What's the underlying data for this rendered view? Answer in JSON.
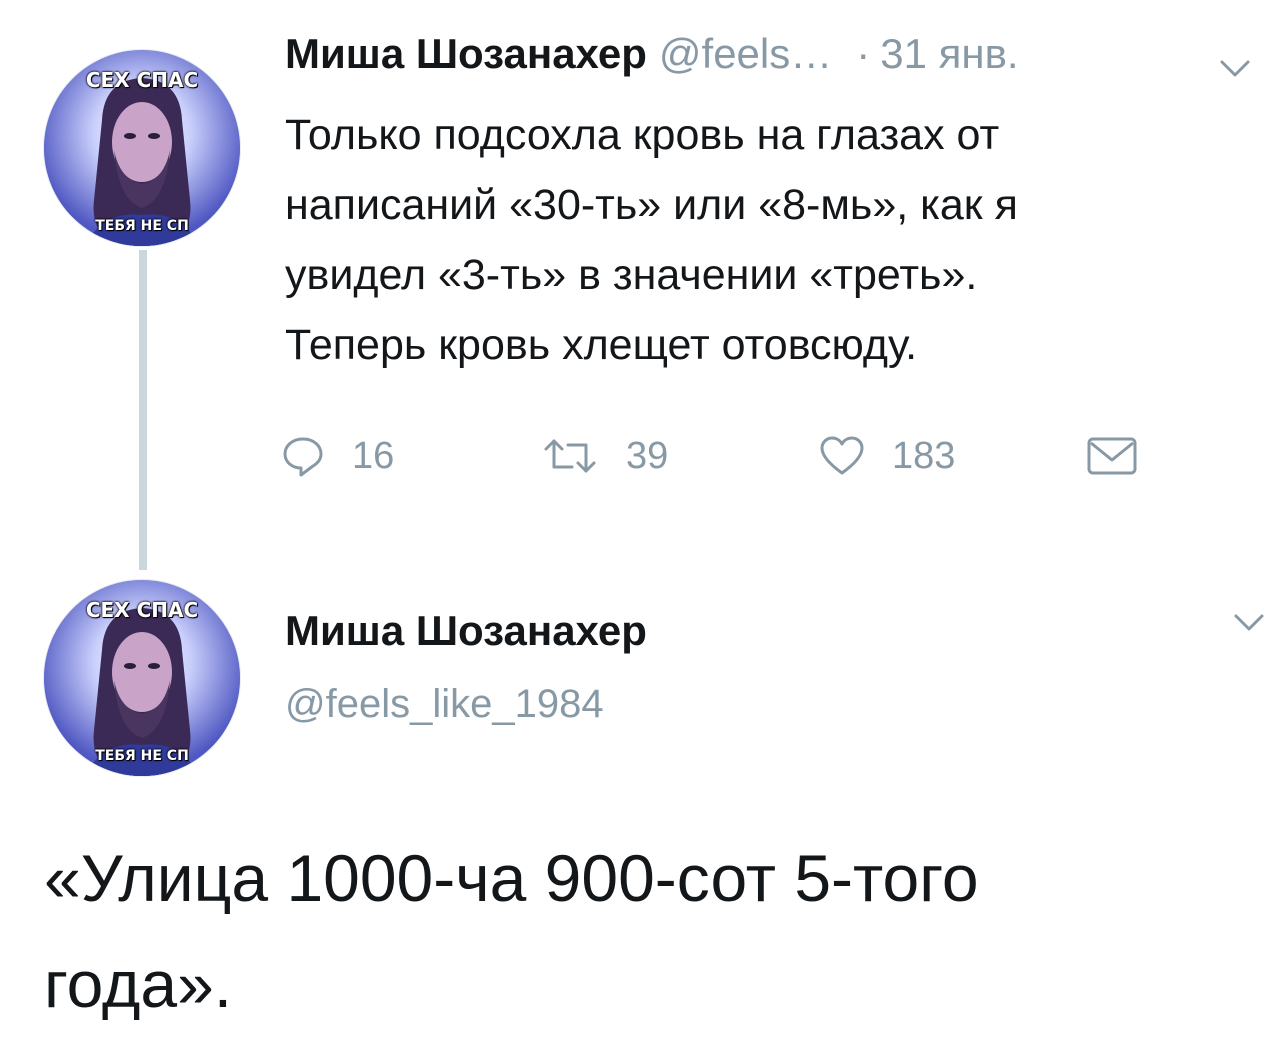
{
  "thread": {
    "tweet1": {
      "display_name": "Миша Шозанахер",
      "handle": "@feels…",
      "separator": "·",
      "date": "31 янв.",
      "text": "Только подсохла кровь на глазах от\nнаписаний «30-ть» или «8-мь», как я\nувидел «3-ть» в значении «треть».\nТеперь кровь хлещет отовсюду.",
      "avatar": {
        "caption_top": "СЕХ СПАС",
        "caption_bottom": "ТЕБЯ НЕ СП"
      },
      "actions": {
        "reply": {
          "icon": "reply-icon",
          "count": "16"
        },
        "retweet": {
          "icon": "retweet-icon",
          "count": "39"
        },
        "like": {
          "icon": "heart-icon",
          "count": "183"
        },
        "dm": {
          "icon": "envelope-icon"
        }
      }
    },
    "tweet2": {
      "display_name": "Миша Шозанахер",
      "handle": "@feels_like_1984",
      "text": "«Улица 1000-ча 900-сот 5-того\nгода».",
      "avatar": {
        "caption_top": "СЕХ СПАС",
        "caption_bottom": "ТЕБЯ НЕ СП"
      }
    }
  },
  "colors": {
    "text_primary": "#14171a",
    "text_secondary": "#8899a6",
    "thread_line": "#ccd6dd",
    "background": "#ffffff"
  }
}
